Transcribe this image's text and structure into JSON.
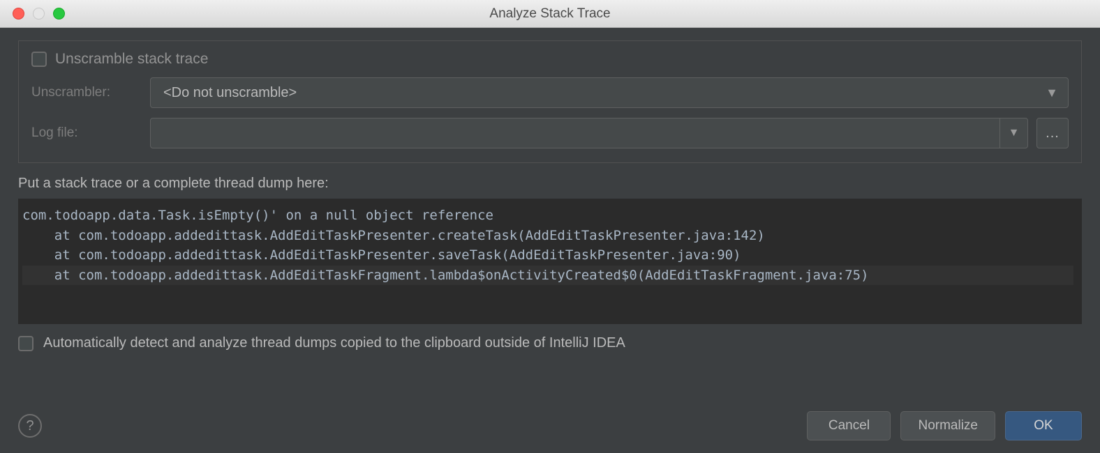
{
  "window": {
    "title": "Analyze Stack Trace"
  },
  "panel": {
    "unscramble_checkbox_label": "Unscramble stack trace",
    "unscrambler_label": "Unscrambler:",
    "unscrambler_value": "<Do not unscramble>",
    "logfile_label": "Log file:",
    "logfile_value": "",
    "browse_label": "..."
  },
  "instruction": "Put a stack trace or a complete thread dump here:",
  "trace_lines": [
    "com.todoapp.data.Task.isEmpty()' on a null object reference",
    "    at com.todoapp.addedittask.AddEditTaskPresenter.createTask(AddEditTaskPresenter.java:142)",
    "    at com.todoapp.addedittask.AddEditTaskPresenter.saveTask(AddEditTaskPresenter.java:90)",
    "    at com.todoapp.addedittask.AddEditTaskFragment.lambda$onActivityCreated$0(AddEditTaskFragment.java:75)"
  ],
  "trace_highlight_index": 3,
  "auto_detect_label": "Automatically detect and analyze thread dumps copied to the clipboard outside of IntelliJ IDEA",
  "footer": {
    "help_label": "?",
    "cancel_label": "Cancel",
    "normalize_label": "Normalize",
    "ok_label": "OK"
  }
}
